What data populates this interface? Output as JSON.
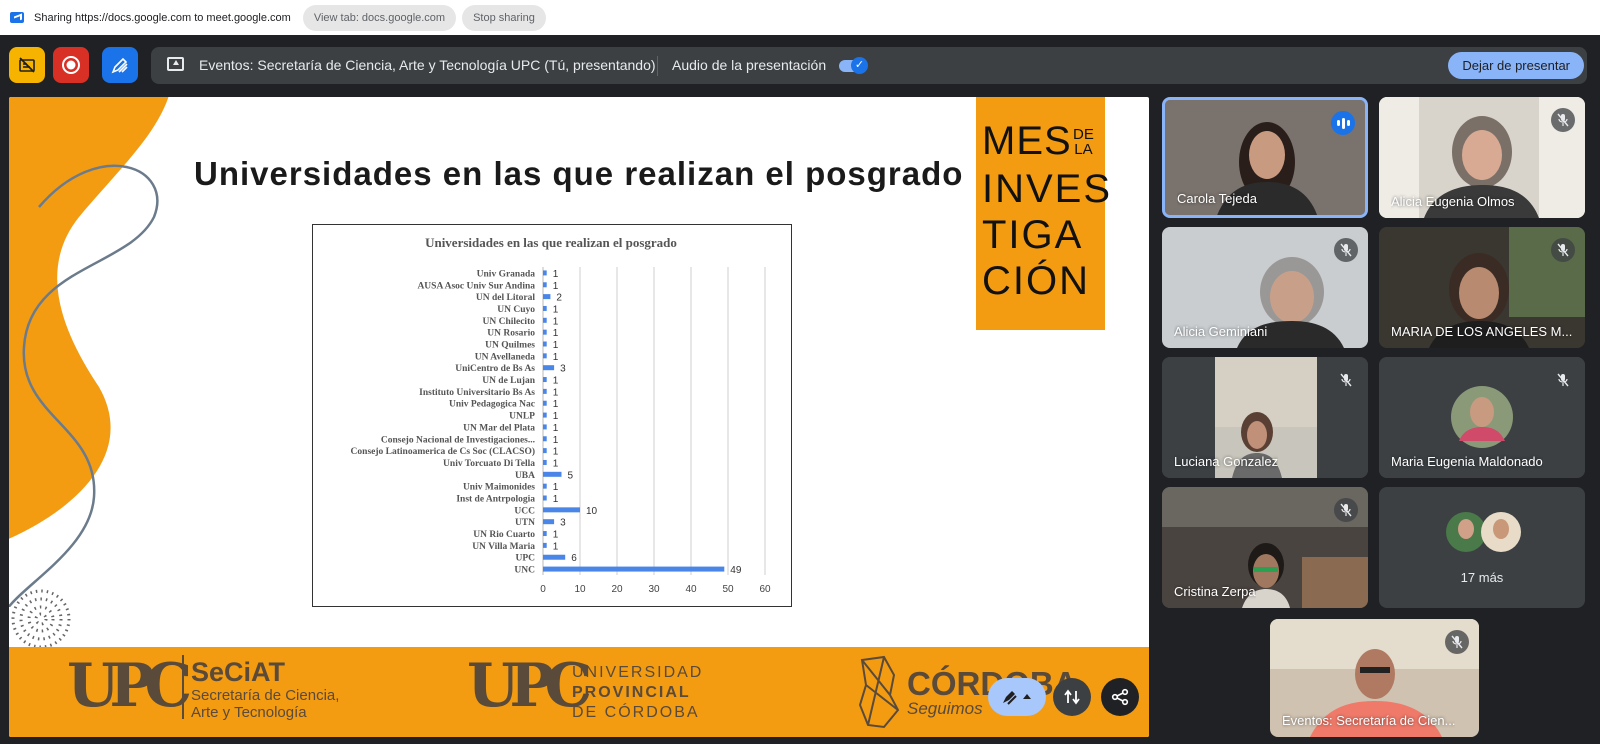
{
  "sharing_bar": {
    "text": "Sharing https://docs.google.com to meet.google.com",
    "view_tab": "View tab: docs.google.com",
    "stop_sharing": "Stop sharing"
  },
  "top_bar": {
    "presentation_title": "Eventos: Secretaría de Ciencia, Arte y Tecnología UPC (Tú, presentando)",
    "audio_label": "Audio de la presentación",
    "audio_on": true,
    "stop_presenting": "Dejar de presentar"
  },
  "slide": {
    "title": "Universidades en las que realizan el posgrado",
    "logo": {
      "line1": "MES",
      "line1_small": "DE\nLA",
      "line2": "INVES",
      "line3": "TIGA",
      "line4": "CIÓN"
    },
    "footer": {
      "upc": "UPC",
      "seciat": "SeCiAT",
      "seciat_sub1": "Secretaría de Ciencia,",
      "seciat_sub2": "Arte y Tecnología",
      "univ1": "UNIVERSIDAD",
      "univ2": "PROVINCIAL",
      "univ3": "DE CÓRDOBA",
      "cordoba": "CÓRDOBA",
      "seguimos": "Seguimos"
    }
  },
  "chart_data": {
    "type": "bar",
    "orientation": "horizontal",
    "title": "Universidades en las que realizan el posgrado",
    "categories": [
      "Univ Granada",
      "AUSA Asoc Univ Sur Andina",
      "UN del Litoral",
      "UN Cuyo",
      "UN Chilecito",
      "UN Rosario",
      "UN Quilmes",
      "UN Avellaneda",
      "UniCentro de Bs As",
      "UN de Lujan",
      "Instituto Universitario Bs As",
      "Univ Pedagogica Nac",
      "UNLP",
      "UN Mar del Plata",
      "Consejo Nacional de Investigaciones...",
      "Consejo Latinoamerica de Cs Soc (CLACSO)",
      "Univ Torcuato Di Tella",
      "UBA",
      "Univ Maimonides",
      "Inst de Antrpologia",
      "UCC",
      "UTN",
      "UN Rio Cuarto",
      "UN Villa Maria",
      "UPC",
      "UNC"
    ],
    "values": [
      1,
      1,
      2,
      1,
      1,
      1,
      1,
      1,
      3,
      1,
      1,
      1,
      1,
      1,
      1,
      1,
      1,
      5,
      1,
      1,
      10,
      3,
      1,
      1,
      6,
      49
    ],
    "xlim": [
      0,
      60
    ],
    "xticks": [
      0,
      10,
      20,
      30,
      40,
      50,
      60
    ],
    "grid": true,
    "bar_color": "#4a86e8"
  },
  "participants": [
    {
      "name": "Carola Tejeda",
      "speaking": true
    },
    {
      "name": "Alicia Eugenia Olmos",
      "muted": true
    },
    {
      "name": "Alicia Geminiani",
      "muted": true
    },
    {
      "name": "MARIA DE LOS ANGELES M...",
      "muted": true
    },
    {
      "name": "Luciana Gonzalez",
      "muted": true
    },
    {
      "name": "Maria Eugenia Maldonado",
      "muted": true
    },
    {
      "name": "Cristina Zerpa",
      "muted": true
    },
    {
      "name": "17 más"
    },
    {
      "name": "Eventos: Secretaría de Cien...",
      "muted": true
    }
  ],
  "colors": {
    "accent": "#8ab4f8",
    "slide_orange": "#f39c12",
    "meet_bg": "#202124"
  }
}
